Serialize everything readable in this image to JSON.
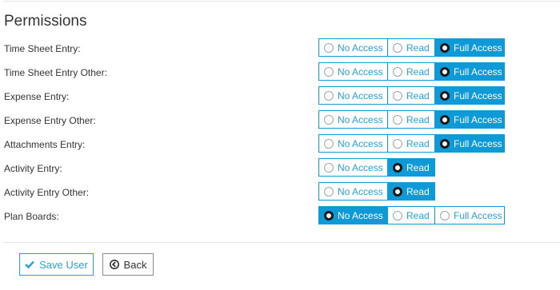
{
  "section": {
    "title": "Permissions"
  },
  "options": {
    "none": "No Access",
    "read": "Read",
    "full": "Full Access"
  },
  "permissions": [
    {
      "label": "Time Sheet Entry:",
      "choices": [
        "none",
        "read",
        "full"
      ],
      "selected": "full"
    },
    {
      "label": "Time Sheet Entry Other:",
      "choices": [
        "none",
        "read",
        "full"
      ],
      "selected": "full"
    },
    {
      "label": "Expense Entry:",
      "choices": [
        "none",
        "read",
        "full"
      ],
      "selected": "full"
    },
    {
      "label": "Expense Entry Other:",
      "choices": [
        "none",
        "read",
        "full"
      ],
      "selected": "full"
    },
    {
      "label": "Attachments Entry:",
      "choices": [
        "none",
        "read",
        "full"
      ],
      "selected": "full"
    },
    {
      "label": "Activity Entry:",
      "choices": [
        "none",
        "read"
      ],
      "selected": "read"
    },
    {
      "label": "Activity Entry Other:",
      "choices": [
        "none",
        "read"
      ],
      "selected": "read"
    },
    {
      "label": "Plan Boards:",
      "choices": [
        "none",
        "read",
        "full"
      ],
      "selected": "none"
    }
  ],
  "footer": {
    "save_label": "Save User",
    "back_label": "Back",
    "save_icon": "check-icon",
    "back_icon": "circle-arrow-left-icon"
  },
  "colors": {
    "accent": "#0e9ad6",
    "text": "#333333"
  }
}
